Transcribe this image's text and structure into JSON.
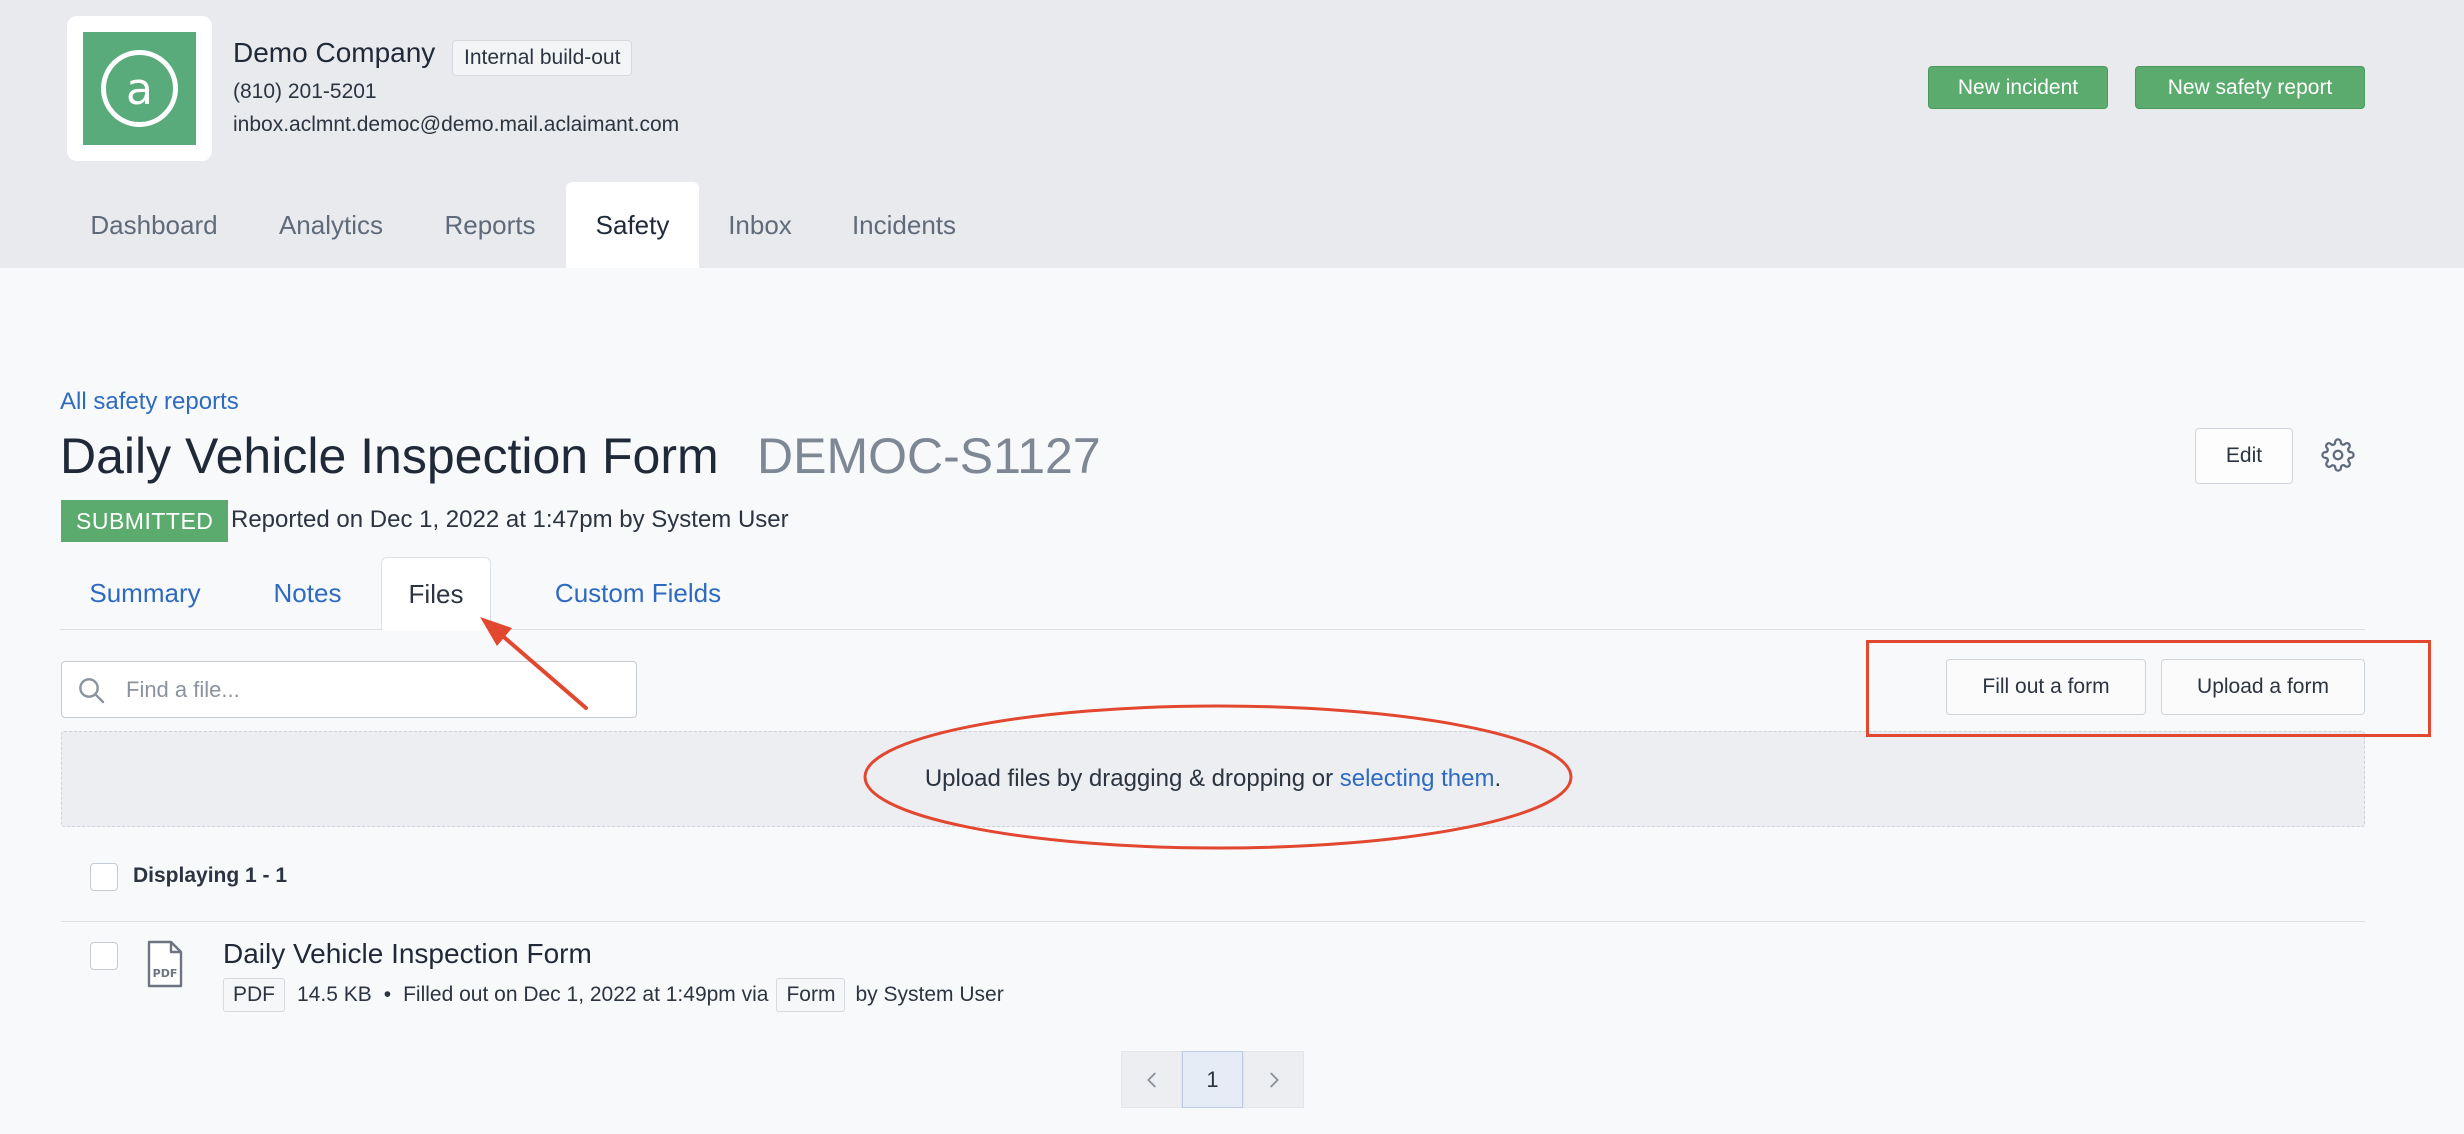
{
  "header": {
    "company_name": "Demo Company",
    "build_badge": "Internal build-out",
    "phone": "(810) 201-5201",
    "email": "inbox.aclmnt.democ@demo.mail.aclaimant.com",
    "new_incident_label": "New incident",
    "new_safety_report_label": "New safety report",
    "logo_icon": "at-sign-icon"
  },
  "nav": {
    "tabs": [
      {
        "label": "Dashboard"
      },
      {
        "label": "Analytics"
      },
      {
        "label": "Reports"
      },
      {
        "label": "Safety"
      },
      {
        "label": "Inbox"
      },
      {
        "label": "Incidents"
      }
    ],
    "active": "Safety"
  },
  "report": {
    "breadcrumb": "All safety reports",
    "title": "Daily Vehicle Inspection Form",
    "id": "DEMOC-S1127",
    "status": "SUBMITTED",
    "reported_line": "Reported on Dec 1, 2022 at 1:47pm by System User",
    "edit_label": "Edit"
  },
  "subtabs": {
    "items": [
      {
        "label": "Summary"
      },
      {
        "label": "Notes"
      },
      {
        "label": "Files"
      },
      {
        "label": "Custom Fields"
      }
    ],
    "active": "Files"
  },
  "files": {
    "search_placeholder": "Find a file...",
    "fill_form_label": "Fill out a form",
    "upload_form_label": "Upload a form",
    "dropzone_text": "Upload files by dragging & dropping or ",
    "dropzone_link": "selecting them",
    "dropzone_end": ".",
    "displaying": "Displaying 1 - 1",
    "items": [
      {
        "title": "Daily Vehicle Inspection Form",
        "type": "PDF",
        "size": "14.5 KB",
        "bullet": "•",
        "filled_text": "Filled out on Dec 1, 2022 at 1:49pm via",
        "via": "Form",
        "by": "by System User",
        "icon": "pdf-file-icon"
      }
    ]
  },
  "pagination": {
    "current": "1"
  },
  "colors": {
    "accent_green": "#5aab6d",
    "link_blue": "#2e6bc0",
    "annotation_red": "#e2472f"
  }
}
